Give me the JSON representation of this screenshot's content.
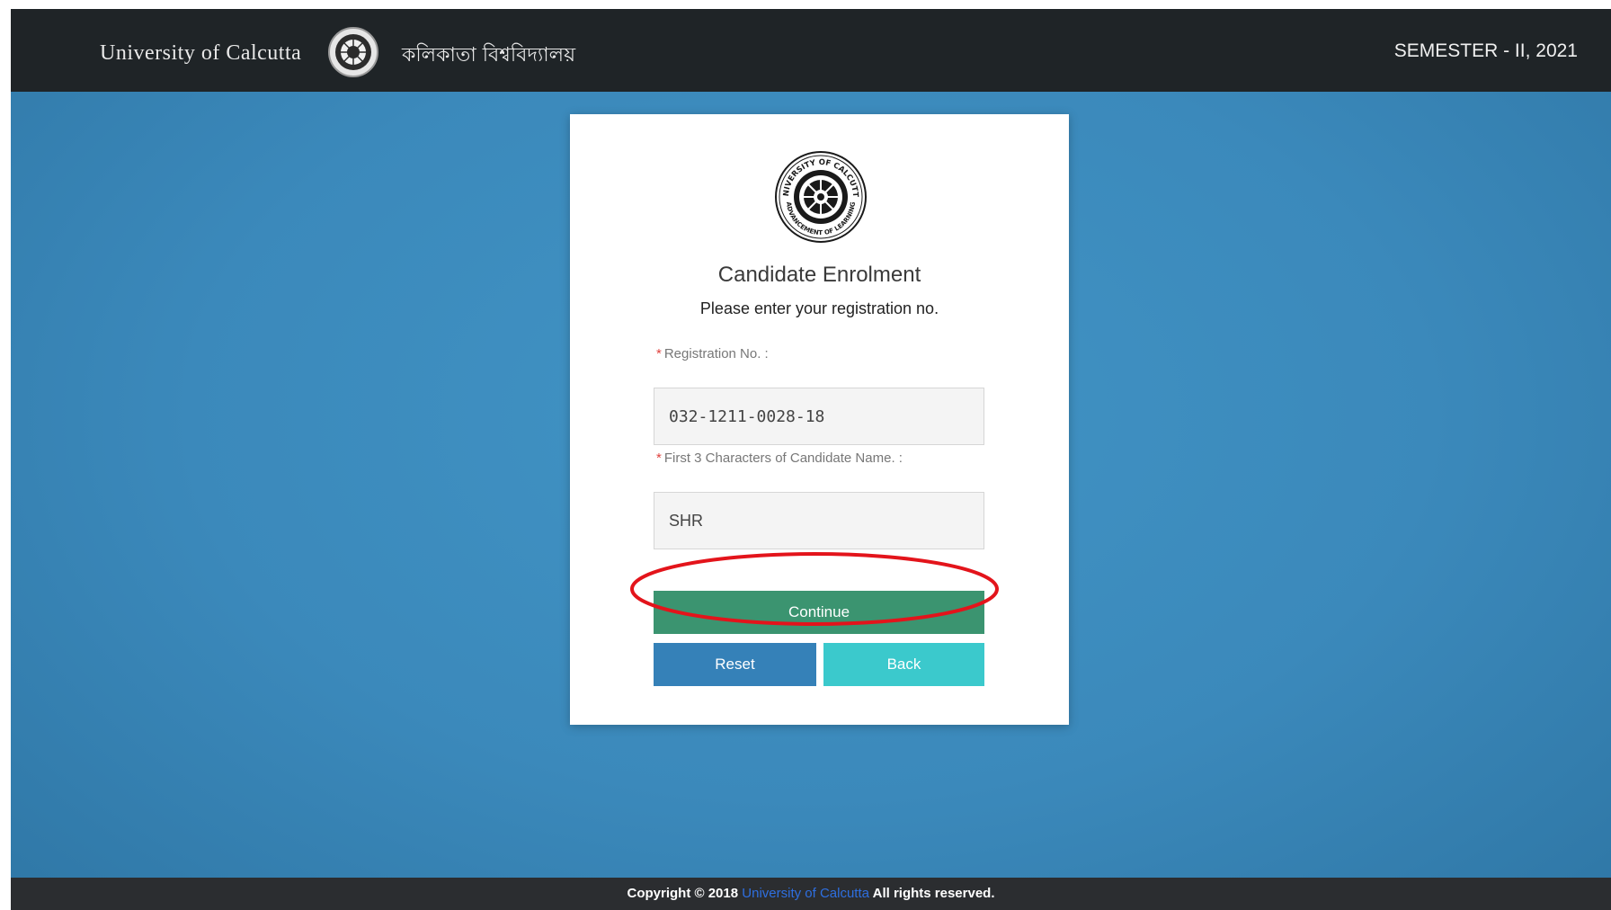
{
  "header": {
    "brand_en": "University of Calcutta",
    "brand_bn": "কলিকাতা বিশ্ববিদ্যালয়",
    "semester": "SEMESTER - II, 2021"
  },
  "card": {
    "seal_text_top": "UNIVERSITY OF CALCUTTA",
    "seal_text_bottom": "ADVANCEMENT OF LEARNING",
    "title": "Candidate Enrolment",
    "subtitle": "Please enter your registration no.",
    "registration": {
      "required_mark": "*",
      "label": "Registration No. :",
      "value": "032-1211-0028-18"
    },
    "name_chars": {
      "required_mark": "*",
      "label": "First 3 Characters of Candidate Name. :",
      "value": "SHR"
    },
    "continue_label": "Continue",
    "reset_label": "Reset",
    "back_label": "Back"
  },
  "footer": {
    "prefix": "Copyright © 2018",
    "link": "University of Calcutta",
    "suffix": "All rights reserved."
  },
  "colors": {
    "topbar": "#1f2427",
    "background": "#3b89bb",
    "continue": "#3b9470",
    "reset": "#3581b8",
    "back": "#3bc9cc",
    "highlight": "#e3141b"
  }
}
